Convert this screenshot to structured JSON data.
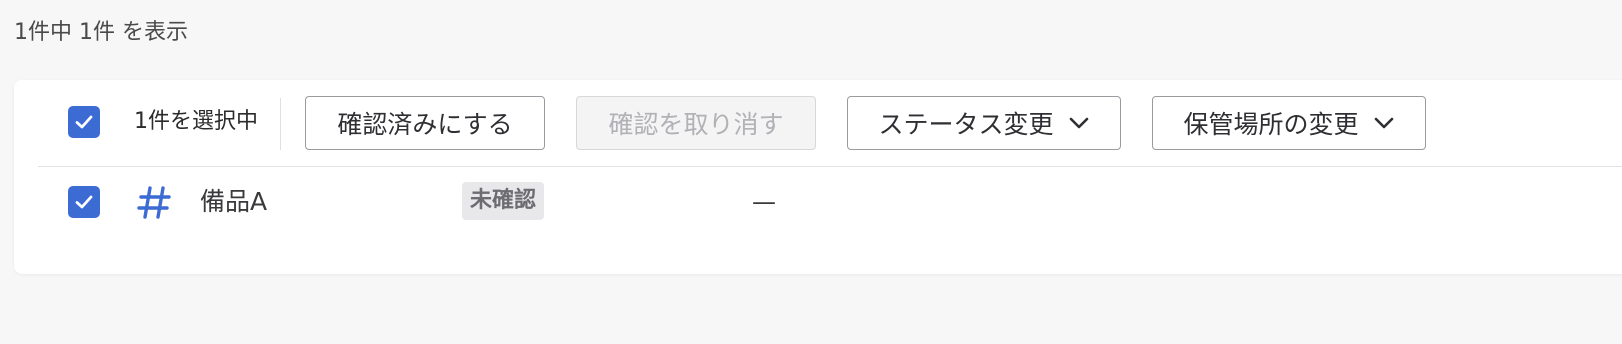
{
  "summary": {
    "count_text": "1件中 1件 を表示"
  },
  "toolbar": {
    "select_all_checked": true,
    "selected_label": "1件を選択中",
    "confirm_label": "確認済みにする",
    "cancel_confirm_label": "確認を取り消す",
    "change_status_label": "ステータス変更",
    "change_location_label": "保管場所の変更"
  },
  "rows": [
    {
      "checked": true,
      "icon": "hash-icon",
      "name": "備品A",
      "status": "未確認",
      "location": "—"
    }
  ],
  "colors": {
    "accent": "#3d6bd4",
    "badge_bg": "#e8e8ea",
    "badge_text": "#6c6c72"
  }
}
